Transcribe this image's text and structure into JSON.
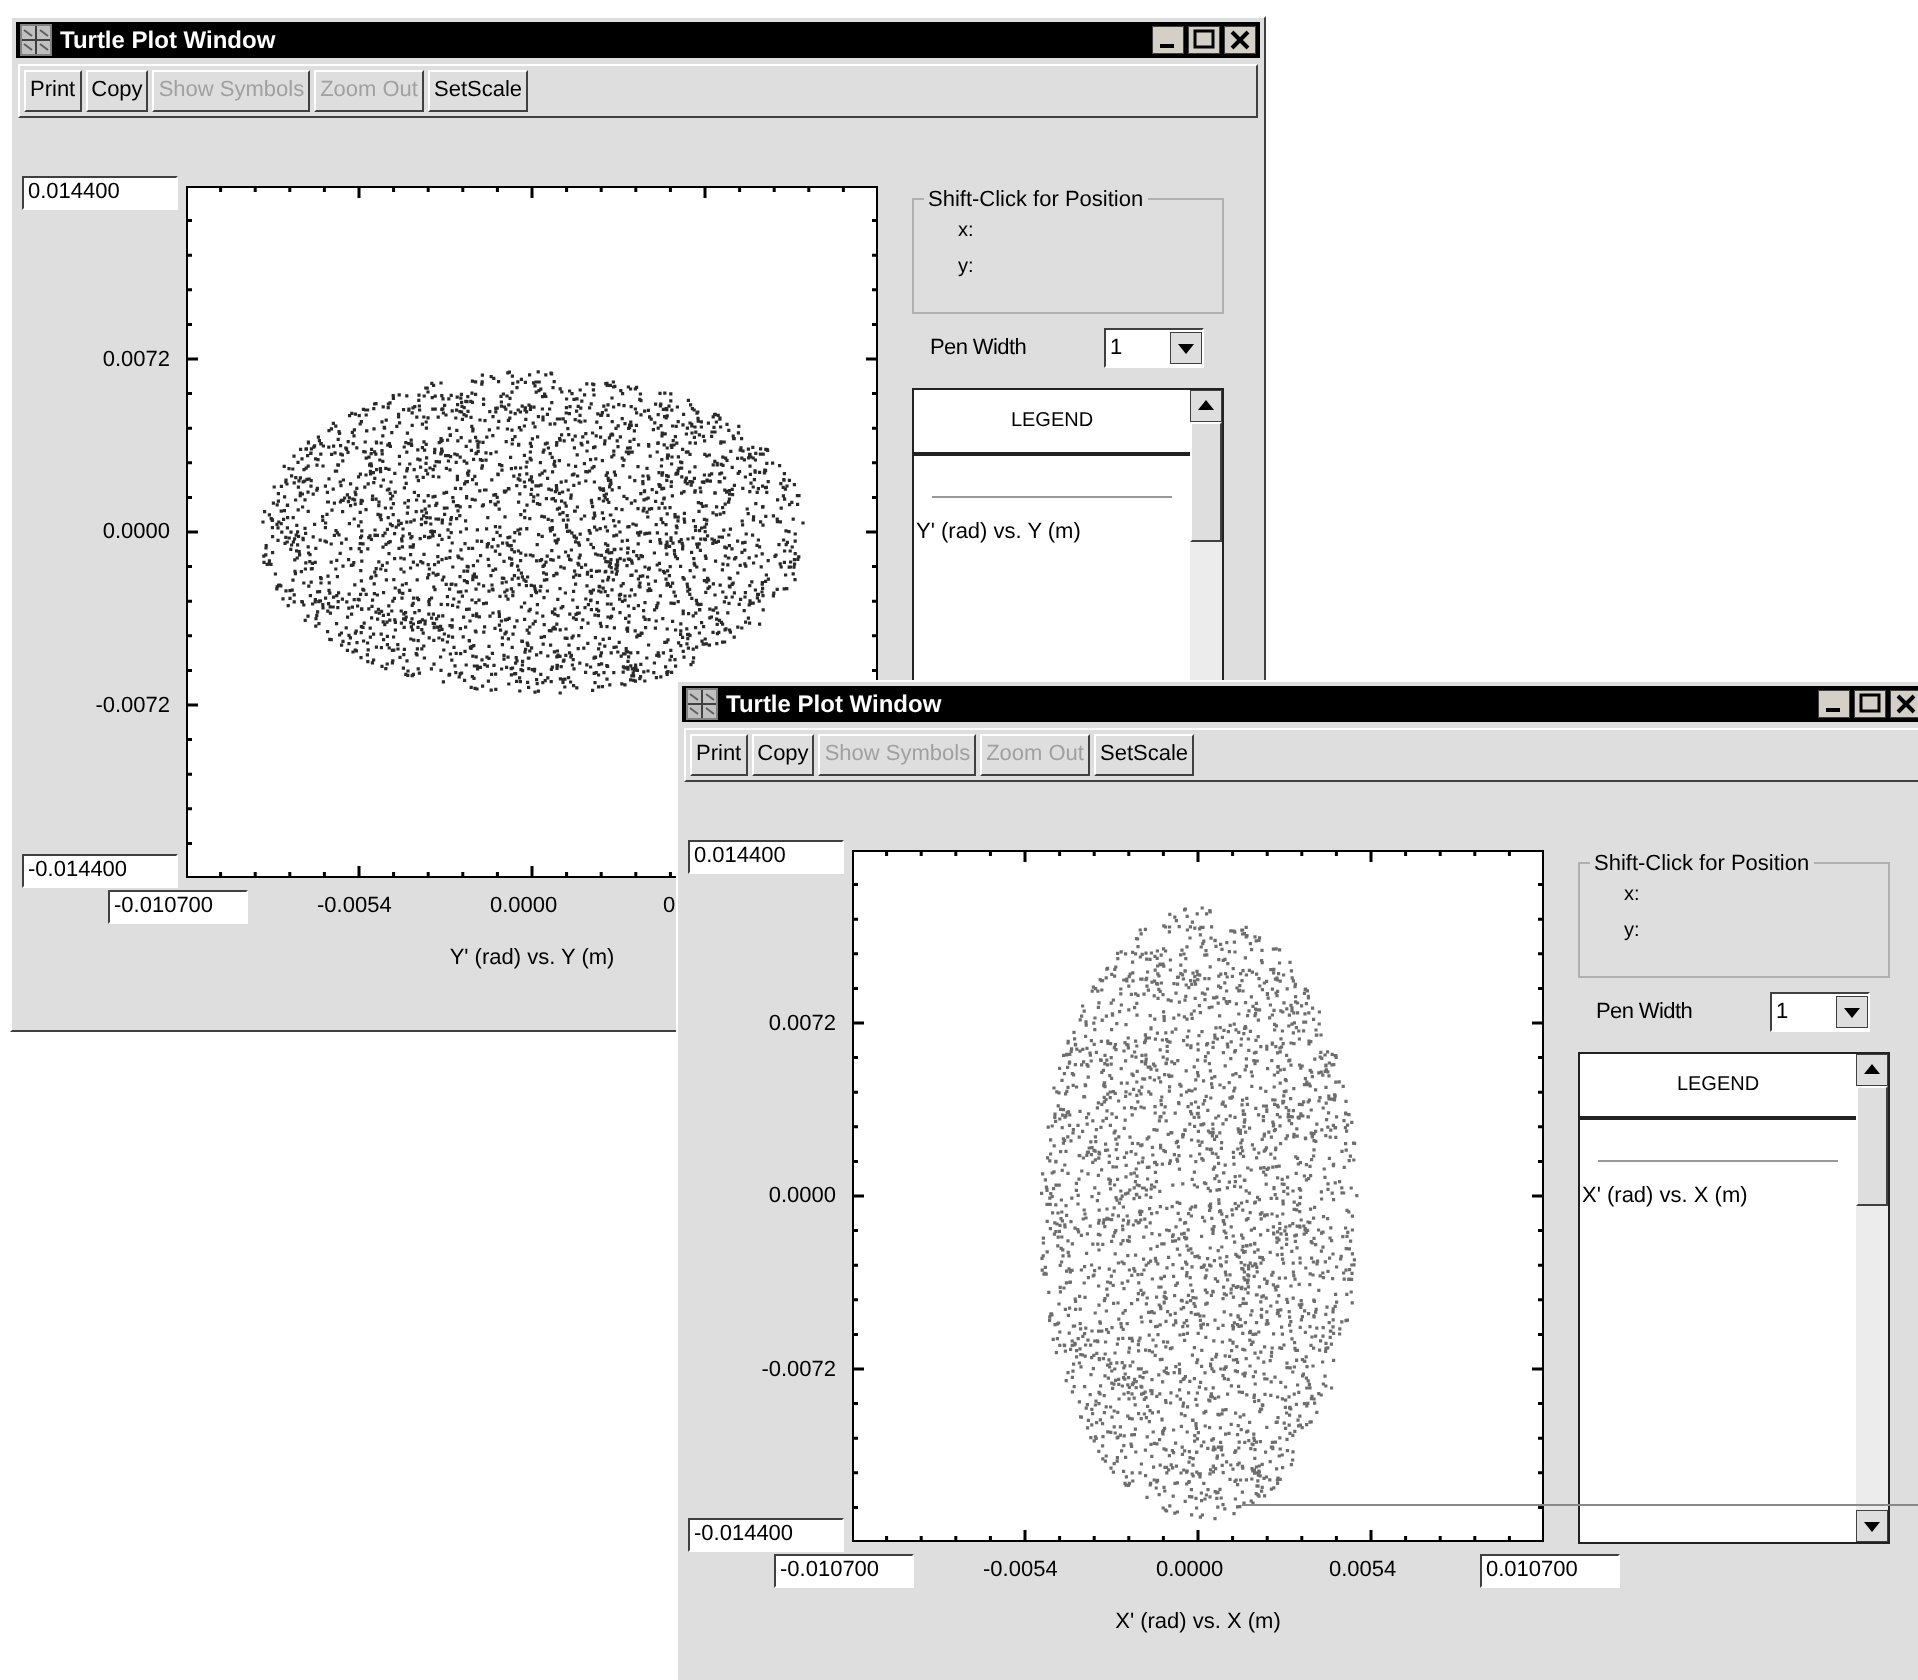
{
  "windows": [
    {
      "title": "Turtle Plot Window",
      "kind": "wide",
      "marker_line": false,
      "toolbar": [
        {
          "label": "Print",
          "disabled": false
        },
        {
          "label": "Copy",
          "disabled": false
        },
        {
          "label": "Show Symbols",
          "disabled": true
        },
        {
          "label": "Zoom Out",
          "disabled": true
        },
        {
          "label": "SetScale",
          "disabled": false
        }
      ],
      "y_max": "0.014400",
      "y_min": "-0.014400",
      "y_ticks": [
        "0.0072",
        "0.0000",
        "-0.0072"
      ],
      "x_min": "-0.010700",
      "x_ticks": [
        "-0.0054",
        "0.0000",
        "0"
      ],
      "x_label": "Y' (rad) vs. Y (m)",
      "position_box": {
        "title": "Shift-Click for Position",
        "x_label": "x:",
        "y_label": "y:"
      },
      "pen_width": {
        "label": "Pen Width",
        "value": "1"
      },
      "legend": {
        "title": "LEGEND",
        "entries": [
          "Y' (rad) vs. Y (m)"
        ]
      }
    },
    {
      "title": "Turtle Plot Window",
      "kind": "tall",
      "marker_line": true,
      "toolbar": [
        {
          "label": "Print",
          "disabled": false
        },
        {
          "label": "Copy",
          "disabled": false
        },
        {
          "label": "Show Symbols",
          "disabled": true
        },
        {
          "label": "Zoom Out",
          "disabled": true
        },
        {
          "label": "SetScale",
          "disabled": false
        }
      ],
      "y_max": "0.014400",
      "y_min": "-0.014400",
      "y_ticks": [
        "0.0072",
        "0.0000",
        "-0.0072"
      ],
      "x_min": "-0.010700",
      "x_ticks": [
        "-0.0054",
        "0.0000",
        "0.0054"
      ],
      "x_max": "0.010700",
      "x_label": "X' (rad) vs. X (m)",
      "position_box": {
        "title": "Shift-Click for Position",
        "x_label": "x:",
        "y_label": "y:"
      },
      "pen_width": {
        "label": "Pen Width",
        "value": "1"
      },
      "legend": {
        "title": "LEGEND",
        "entries": [
          "X' (rad) vs. X (m)"
        ]
      }
    }
  ]
}
